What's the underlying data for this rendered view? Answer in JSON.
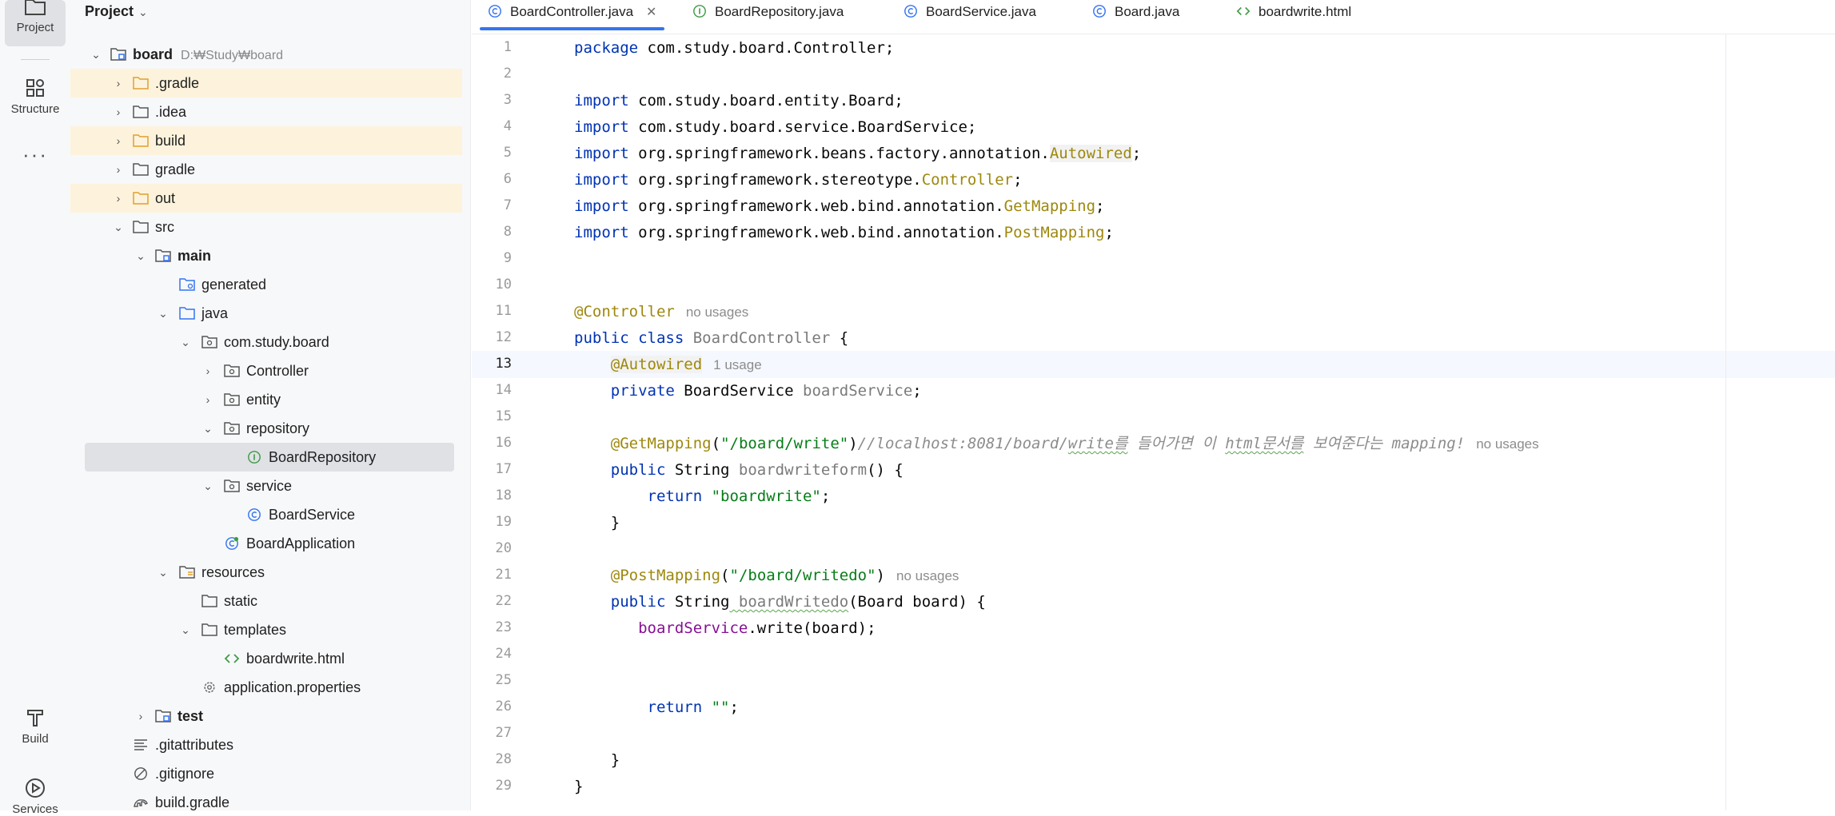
{
  "toolstrip": {
    "project": "Project",
    "structure": "Structure",
    "build": "Build",
    "services": "Services"
  },
  "panel": {
    "title": "Project",
    "root_name": "board",
    "root_path": "D:\\Study\\board"
  },
  "tree": [
    {
      "label": "board",
      "path": "D:₩Study₩board"
    },
    {
      "label": ".gradle"
    },
    {
      "label": ".idea"
    },
    {
      "label": "build"
    },
    {
      "label": "gradle"
    },
    {
      "label": "out"
    },
    {
      "label": "src"
    },
    {
      "label": "main"
    },
    {
      "label": "generated"
    },
    {
      "label": "java"
    },
    {
      "label": "com.study.board"
    },
    {
      "label": "Controller"
    },
    {
      "label": "entity"
    },
    {
      "label": "repository"
    },
    {
      "label": "BoardRepository"
    },
    {
      "label": "service"
    },
    {
      "label": "BoardService"
    },
    {
      "label": "BoardApplication"
    },
    {
      "label": "resources"
    },
    {
      "label": "static"
    },
    {
      "label": "templates"
    },
    {
      "label": "boardwrite.html"
    },
    {
      "label": "application.properties"
    },
    {
      "label": "test"
    },
    {
      "label": ".gitattributes"
    },
    {
      "label": ".gitignore"
    },
    {
      "label": "build.gradle"
    }
  ],
  "tabs": [
    {
      "label": "BoardController.java",
      "active": true
    },
    {
      "label": "BoardRepository.java"
    },
    {
      "label": "BoardService.java"
    },
    {
      "label": "Board.java"
    },
    {
      "label": "boardwrite.html"
    }
  ],
  "editor": {
    "current_line": 13,
    "line_numbers": [
      "1",
      "2",
      "3",
      "4",
      "5",
      "6",
      "7",
      "8",
      "9",
      "10",
      "11",
      "12",
      "13",
      "14",
      "15",
      "16",
      "17",
      "18",
      "19",
      "20",
      "21",
      "22",
      "23",
      "24",
      "25",
      "26",
      "27",
      "28",
      "29"
    ],
    "code": {
      "l1_kw": "package",
      "l1_rest": " com.study.board.Controller;",
      "import_kw": "import",
      "l3_rest": " com.study.board.entity.Board;",
      "l4_rest": " com.study.board.service.BoardService;",
      "l5_pre": " org.springframework.beans.factory.annotation.",
      "l5_ann": "Autowired",
      "l6_pre": " org.springframework.stereotype.",
      "l6_ann": "Controller",
      "l7_pre": " org.springframework.web.bind.annotation.",
      "l7_ann": "GetMapping",
      "l8_pre": " org.springframework.web.bind.annotation.",
      "l8_ann": "PostMapping",
      "semi": ";",
      "l11_ann": "@Controller",
      "no_usages": "no usages",
      "l12_kw": "public class",
      "l12_cls": " BoardController",
      "l12_rest": " {",
      "l13_ann": "@Autowired",
      "l13_hint": "1 usage",
      "l14_kw": "private",
      "l14_type": " BoardService",
      "l14_field": " boardService",
      "l14_end": ";",
      "l16_ann": "@GetMapping",
      "l16_open": "(",
      "l16_str": "\"/board/write\"",
      "l16_close": ")",
      "l16_c1": "//localhost:8081/board/",
      "l16_c2": "write를",
      "l16_c3": " 들어가면 이 ",
      "l16_c4": "html문서를",
      "l16_c5": " 보여준다는 mapping!",
      "l17_kw": "public",
      "l17_type": " String",
      "l17_m": " boardwriteform",
      "l17_rest": "() {",
      "l18_kw": "return",
      "l18_str": " \"boardwrite\"",
      "l18_end": ";",
      "close_brace": "}",
      "l21_ann": "@PostMapping",
      "l21_open": "(",
      "l21_str": "\"/board/writedo\"",
      "l21_close": ")",
      "l22_kw": "public",
      "l22_type": " String",
      "l22_m": " boardWritedo",
      "l22_rest": "(Board board) {",
      "l23_field": "boardService",
      "l23_rest": ".write(board);",
      "l26_kw": "return",
      "l26_str": " \"\"",
      "l26_end": ";"
    }
  }
}
